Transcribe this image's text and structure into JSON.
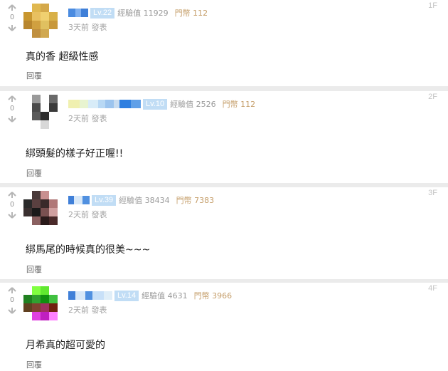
{
  "comments": [
    {
      "votes": "0",
      "level": "Lv.22",
      "exp": "經驗值 11929",
      "coins": "門幣 112",
      "time": "3天前 發表",
      "floor": "1F",
      "content": "真的香 超級性感",
      "reply": "回覆",
      "avatar_colors": [
        "#ffffff",
        "#e0b850",
        "#d4a84a",
        "#ffffff",
        "#c8962e",
        "#e8c060",
        "#f0d070",
        "#d8b048",
        "#b8862e",
        "#d0a040",
        "#e0c060",
        "#c8983a",
        "#ffffff",
        "#c09040",
        "#d0a850",
        "#ffffff"
      ],
      "name_colors": [
        "#4a8be0",
        "#7fb0f0",
        "#3f7fd8"
      ]
    },
    {
      "votes": "0",
      "level": "Lv.10",
      "exp": "經驗值 2526",
      "coins": "門幣 112",
      "time": "2天前 發表",
      "floor": "2F",
      "content": "綁頭髮的樣子好正喔!!",
      "reply": "回覆",
      "avatar_colors": [
        "#ffffff",
        "#9a9a9a",
        "#ffffff",
        "#6a6a6a",
        "#ffffff",
        "#4a4a4a",
        "#ffffff",
        "#3a3a3a",
        "#ffffff",
        "#5a5a5a",
        "#2e2e2e",
        "#ffffff",
        "#ffffff",
        "#ffffff",
        "#d8d8d8",
        "#ffffff"
      ],
      "name_colors": [
        "#f0f0b0",
        "#e8f4d0",
        "#d8ecf8",
        "#b8d8f4",
        "#9cc4ee",
        "#c8dcf0",
        "#2f7fe0",
        "#60a0e8"
      ]
    },
    {
      "votes": "0",
      "level": "Lv.39",
      "exp": "經驗值 38434",
      "coins": "門幣 7383",
      "time": "2天前 發表",
      "floor": "3F",
      "content": "綁馬尾的時候真的很美~~~",
      "reply": "回覆",
      "avatar_colors": [
        "#ffffff",
        "#4a3a3a",
        "#c89090",
        "#ffffff",
        "#2a2a2a",
        "#5a4040",
        "#3a2a2a",
        "#b07878",
        "#3a3030",
        "#1a1a1a",
        "#7a5050",
        "#d0a0a0",
        "#ffffff",
        "#8a6060",
        "#2a1a1a",
        "#4a2a2a"
      ],
      "name_colors": [
        "#3f7fd8",
        "#d8e8f8",
        "#5090e0"
      ]
    },
    {
      "votes": "0",
      "level": "Lv.14",
      "exp": "經驗值 4631",
      "coins": "門幣 3966",
      "time": "2天前 發表",
      "floor": "4F",
      "content": "月希真的超可愛的",
      "reply": "回覆",
      "avatar_colors": [
        "#ffffff",
        "#80ff40",
        "#60e830",
        "#ffffff",
        "#208020",
        "#30a030",
        "#109010",
        "#40c040",
        "#604020",
        "#804030",
        "#a03060",
        "#702010",
        "#ffffff",
        "#e040e0",
        "#c020c0",
        "#ff80ff"
      ],
      "name_colors": [
        "#3f7fd8",
        "#d8e8f8",
        "#5090e0",
        "#c8e0f8",
        "#e0eef8"
      ]
    }
  ],
  "colors": {
    "level_badge": "#c1ddf5",
    "coin_text": "#c59e6a",
    "meta_text": "#9a9a9a"
  },
  "icons": {
    "up": "arrow-up-icon",
    "down": "arrow-down-icon"
  }
}
